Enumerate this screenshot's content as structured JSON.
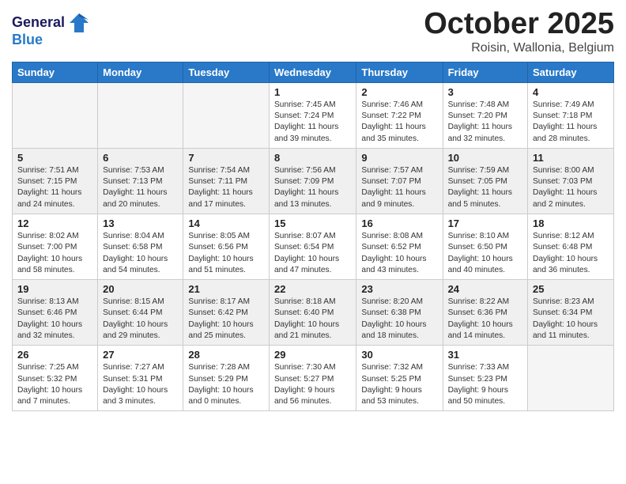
{
  "logo": {
    "line1": "General",
    "line2": "Blue"
  },
  "header": {
    "month": "October 2025",
    "location": "Roisin, Wallonia, Belgium"
  },
  "weekdays": [
    "Sunday",
    "Monday",
    "Tuesday",
    "Wednesday",
    "Thursday",
    "Friday",
    "Saturday"
  ],
  "weeks": [
    [
      {
        "day": "",
        "info": ""
      },
      {
        "day": "",
        "info": ""
      },
      {
        "day": "",
        "info": ""
      },
      {
        "day": "1",
        "info": "Sunrise: 7:45 AM\nSunset: 7:24 PM\nDaylight: 11 hours\nand 39 minutes."
      },
      {
        "day": "2",
        "info": "Sunrise: 7:46 AM\nSunset: 7:22 PM\nDaylight: 11 hours\nand 35 minutes."
      },
      {
        "day": "3",
        "info": "Sunrise: 7:48 AM\nSunset: 7:20 PM\nDaylight: 11 hours\nand 32 minutes."
      },
      {
        "day": "4",
        "info": "Sunrise: 7:49 AM\nSunset: 7:18 PM\nDaylight: 11 hours\nand 28 minutes."
      }
    ],
    [
      {
        "day": "5",
        "info": "Sunrise: 7:51 AM\nSunset: 7:15 PM\nDaylight: 11 hours\nand 24 minutes."
      },
      {
        "day": "6",
        "info": "Sunrise: 7:53 AM\nSunset: 7:13 PM\nDaylight: 11 hours\nand 20 minutes."
      },
      {
        "day": "7",
        "info": "Sunrise: 7:54 AM\nSunset: 7:11 PM\nDaylight: 11 hours\nand 17 minutes."
      },
      {
        "day": "8",
        "info": "Sunrise: 7:56 AM\nSunset: 7:09 PM\nDaylight: 11 hours\nand 13 minutes."
      },
      {
        "day": "9",
        "info": "Sunrise: 7:57 AM\nSunset: 7:07 PM\nDaylight: 11 hours\nand 9 minutes."
      },
      {
        "day": "10",
        "info": "Sunrise: 7:59 AM\nSunset: 7:05 PM\nDaylight: 11 hours\nand 5 minutes."
      },
      {
        "day": "11",
        "info": "Sunrise: 8:00 AM\nSunset: 7:03 PM\nDaylight: 11 hours\nand 2 minutes."
      }
    ],
    [
      {
        "day": "12",
        "info": "Sunrise: 8:02 AM\nSunset: 7:00 PM\nDaylight: 10 hours\nand 58 minutes."
      },
      {
        "day": "13",
        "info": "Sunrise: 8:04 AM\nSunset: 6:58 PM\nDaylight: 10 hours\nand 54 minutes."
      },
      {
        "day": "14",
        "info": "Sunrise: 8:05 AM\nSunset: 6:56 PM\nDaylight: 10 hours\nand 51 minutes."
      },
      {
        "day": "15",
        "info": "Sunrise: 8:07 AM\nSunset: 6:54 PM\nDaylight: 10 hours\nand 47 minutes."
      },
      {
        "day": "16",
        "info": "Sunrise: 8:08 AM\nSunset: 6:52 PM\nDaylight: 10 hours\nand 43 minutes."
      },
      {
        "day": "17",
        "info": "Sunrise: 8:10 AM\nSunset: 6:50 PM\nDaylight: 10 hours\nand 40 minutes."
      },
      {
        "day": "18",
        "info": "Sunrise: 8:12 AM\nSunset: 6:48 PM\nDaylight: 10 hours\nand 36 minutes."
      }
    ],
    [
      {
        "day": "19",
        "info": "Sunrise: 8:13 AM\nSunset: 6:46 PM\nDaylight: 10 hours\nand 32 minutes."
      },
      {
        "day": "20",
        "info": "Sunrise: 8:15 AM\nSunset: 6:44 PM\nDaylight: 10 hours\nand 29 minutes."
      },
      {
        "day": "21",
        "info": "Sunrise: 8:17 AM\nSunset: 6:42 PM\nDaylight: 10 hours\nand 25 minutes."
      },
      {
        "day": "22",
        "info": "Sunrise: 8:18 AM\nSunset: 6:40 PM\nDaylight: 10 hours\nand 21 minutes."
      },
      {
        "day": "23",
        "info": "Sunrise: 8:20 AM\nSunset: 6:38 PM\nDaylight: 10 hours\nand 18 minutes."
      },
      {
        "day": "24",
        "info": "Sunrise: 8:22 AM\nSunset: 6:36 PM\nDaylight: 10 hours\nand 14 minutes."
      },
      {
        "day": "25",
        "info": "Sunrise: 8:23 AM\nSunset: 6:34 PM\nDaylight: 10 hours\nand 11 minutes."
      }
    ],
    [
      {
        "day": "26",
        "info": "Sunrise: 7:25 AM\nSunset: 5:32 PM\nDaylight: 10 hours\nand 7 minutes."
      },
      {
        "day": "27",
        "info": "Sunrise: 7:27 AM\nSunset: 5:31 PM\nDaylight: 10 hours\nand 3 minutes."
      },
      {
        "day": "28",
        "info": "Sunrise: 7:28 AM\nSunset: 5:29 PM\nDaylight: 10 hours\nand 0 minutes."
      },
      {
        "day": "29",
        "info": "Sunrise: 7:30 AM\nSunset: 5:27 PM\nDaylight: 9 hours\nand 56 minutes."
      },
      {
        "day": "30",
        "info": "Sunrise: 7:32 AM\nSunset: 5:25 PM\nDaylight: 9 hours\nand 53 minutes."
      },
      {
        "day": "31",
        "info": "Sunrise: 7:33 AM\nSunset: 5:23 PM\nDaylight: 9 hours\nand 50 minutes."
      },
      {
        "day": "",
        "info": ""
      }
    ]
  ],
  "shaded_weeks": [
    1,
    3
  ],
  "empty_days_week0": [
    0,
    1,
    2
  ],
  "empty_days_week4_last": [
    6
  ]
}
